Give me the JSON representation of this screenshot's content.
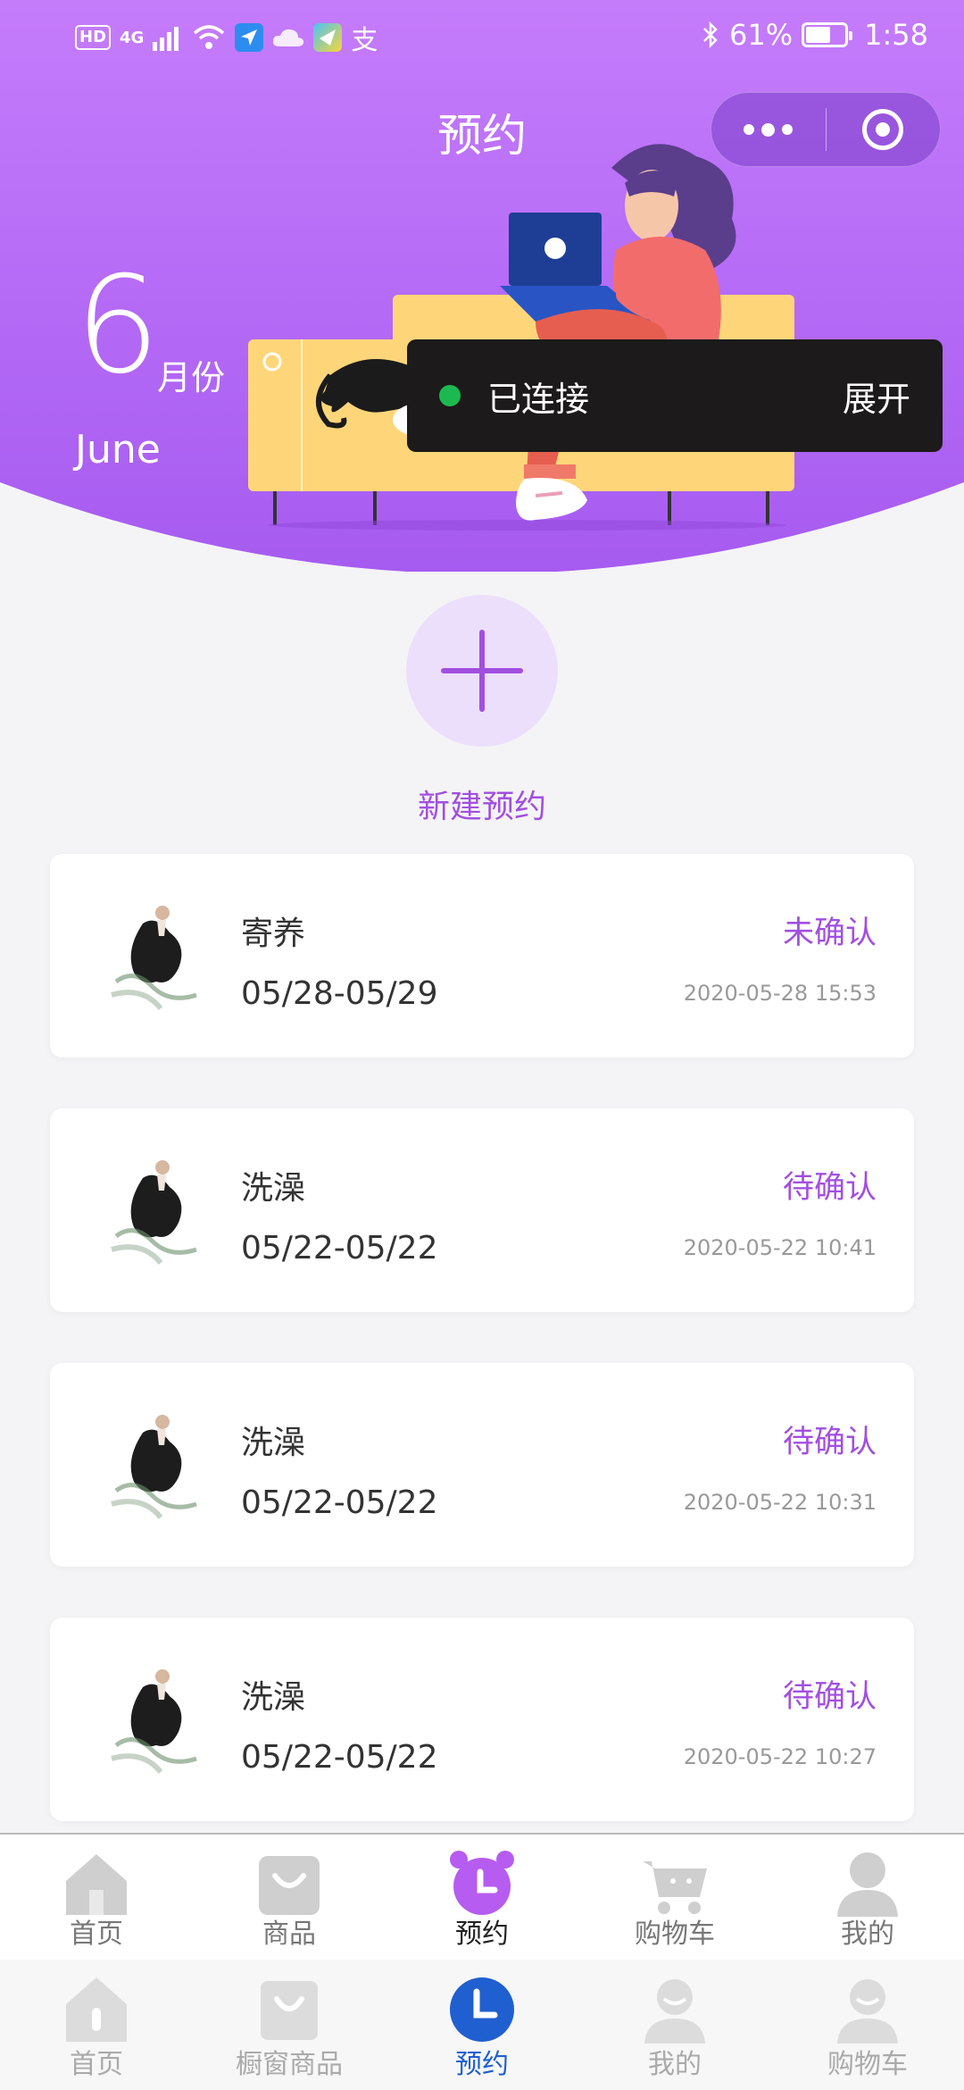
{
  "status_bar": {
    "hd": "HD",
    "network": "4G",
    "battery_text": "61%",
    "battery_level": 0.61,
    "time": "1:58",
    "alipay_glyph": "支"
  },
  "header": {
    "title": "预约",
    "month_number": "6",
    "month_suffix": "月份",
    "month_english": "June",
    "gradient_top": "#c57cfb",
    "gradient_bottom": "#a65bf0"
  },
  "toast": {
    "text": "已连接",
    "action": "展开"
  },
  "new_booking": {
    "label": "新建预约"
  },
  "accent_color": "#a24fe0",
  "appointments": [
    {
      "service": "寄养",
      "date_range": "05/28-05/29",
      "status": "未确认",
      "created": "2020-05-28 15:53"
    },
    {
      "service": "洗澡",
      "date_range": "05/22-05/22",
      "status": "待确认",
      "created": "2020-05-22 10:41"
    },
    {
      "service": "洗澡",
      "date_range": "05/22-05/22",
      "status": "待确认",
      "created": "2020-05-22 10:31"
    },
    {
      "service": "洗澡",
      "date_range": "05/22-05/22",
      "status": "待确认",
      "created": "2020-05-22 10:27"
    }
  ],
  "tabbar_top": [
    {
      "label": "首页",
      "icon": "home-icon"
    },
    {
      "label": "商品",
      "icon": "bag-icon"
    },
    {
      "label": "预约",
      "icon": "alarm-clock-icon",
      "active": true
    },
    {
      "label": "购物车",
      "icon": "cart-icon"
    },
    {
      "label": "我的",
      "icon": "user-icon"
    }
  ],
  "tabbar_bottom": [
    {
      "label": "首页",
      "icon": "home-icon"
    },
    {
      "label": "橱窗商品",
      "icon": "bag-icon"
    },
    {
      "label": "预约",
      "icon": "clock-icon",
      "active": true
    },
    {
      "label": "我的",
      "icon": "user-icon"
    },
    {
      "label": "购物车",
      "icon": "user-icon"
    }
  ]
}
